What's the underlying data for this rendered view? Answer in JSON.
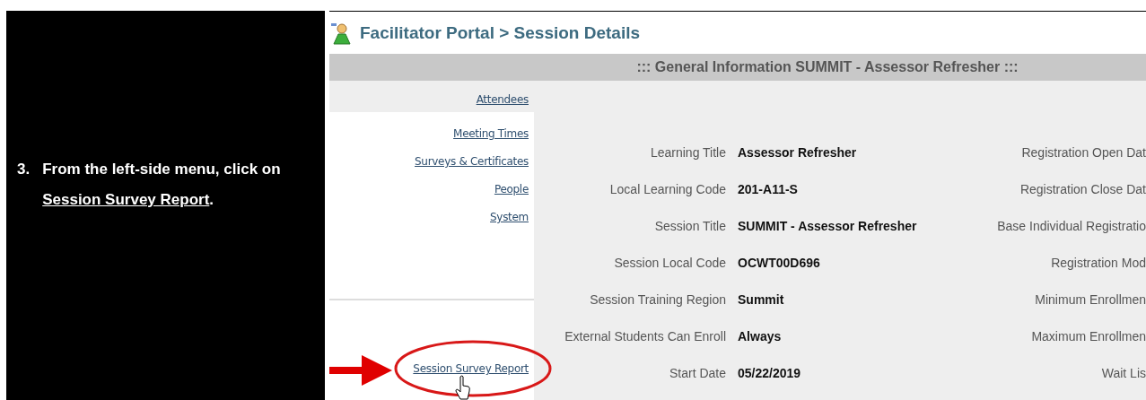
{
  "instruction": {
    "number": "3.",
    "text": "From  the left-side menu, click on",
    "emphasis": "Session Survey Report",
    "end": "."
  },
  "portal": {
    "title": "Facilitator Portal > Session Details",
    "section_title": "::: General Information SUMMIT - Assessor Refresher :::"
  },
  "menu": {
    "items": [
      {
        "label": "Attendees"
      },
      {
        "label": "Meeting Times"
      },
      {
        "label": "Surveys & Certificates"
      },
      {
        "label": "People"
      },
      {
        "label": "System"
      }
    ],
    "report_link": {
      "label": "Session Survey Report",
      "highlighted": true
    }
  },
  "fields": [
    {
      "label": "Learning Title",
      "value": "Assessor Refresher",
      "side_label": "Registration Open Dat"
    },
    {
      "label": "Local Learning Code",
      "value": "201-A11-S",
      "side_label": "Registration Close Dat"
    },
    {
      "label": "Session Title",
      "value": "SUMMIT - Assessor Refresher",
      "side_label": "Base Individual Registratio"
    },
    {
      "label": "Session Local Code",
      "value": "OCWT00D696",
      "side_label": "Registration Mod"
    },
    {
      "label": "Session Training Region",
      "value": "Summit",
      "side_label": "Minimum Enrollmen"
    },
    {
      "label": "External Students Can Enroll",
      "value": "Always",
      "side_label": "Maximum Enrollmen"
    },
    {
      "label": "Start Date",
      "value": "05/22/2019",
      "side_label": "Wait Lis"
    }
  ]
}
